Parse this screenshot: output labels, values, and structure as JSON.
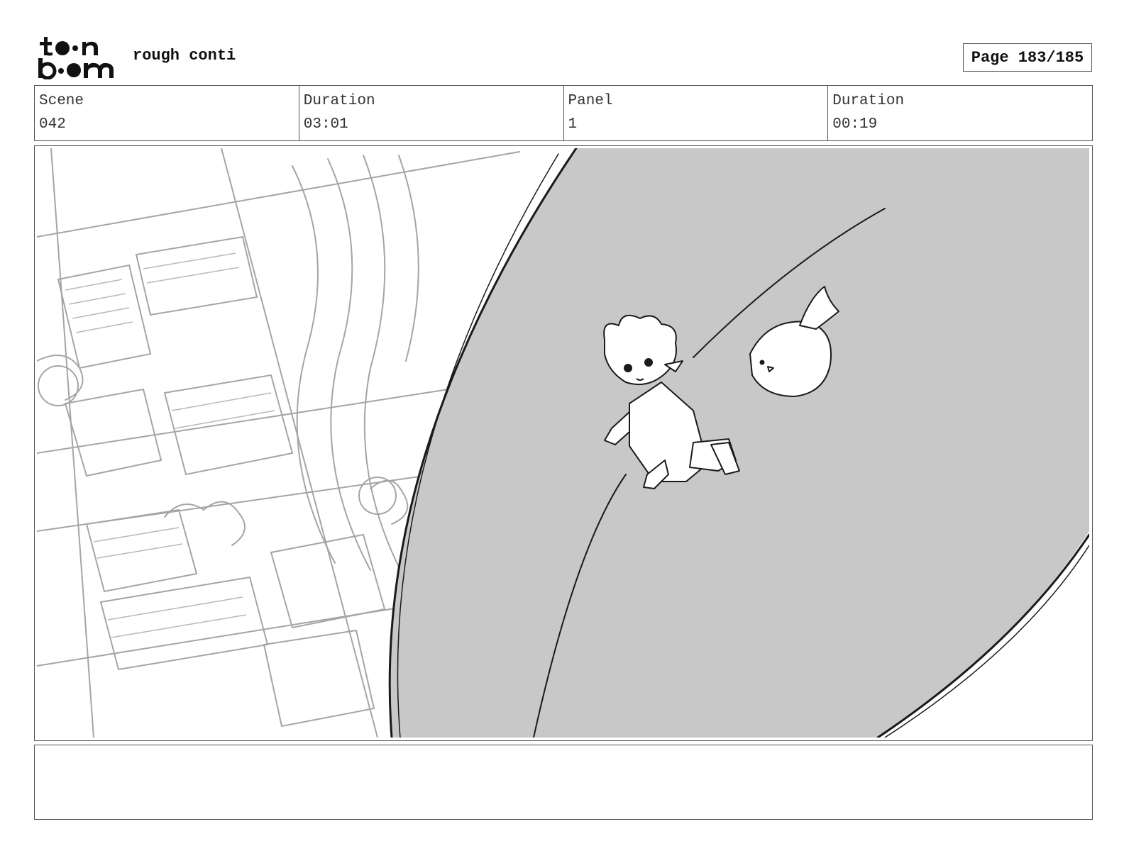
{
  "header": {
    "logo_text": "toon boom",
    "title": "rough conti",
    "page_label": "Page 183/185"
  },
  "info": {
    "scene_label": "Scene",
    "scene_value": "042",
    "scene_duration_label": "Duration",
    "scene_duration_value": "03:01",
    "panel_label": "Panel",
    "panel_value": "1",
    "panel_duration_label": "Duration",
    "panel_duration_value": "00:19"
  },
  "panel": {
    "icon": "storyboard-sketch",
    "colors": {
      "sky": "#c8c8c8",
      "ink": "#1a1a1a",
      "sketch": "#9a9a9a"
    }
  },
  "notes": {
    "text": ""
  }
}
